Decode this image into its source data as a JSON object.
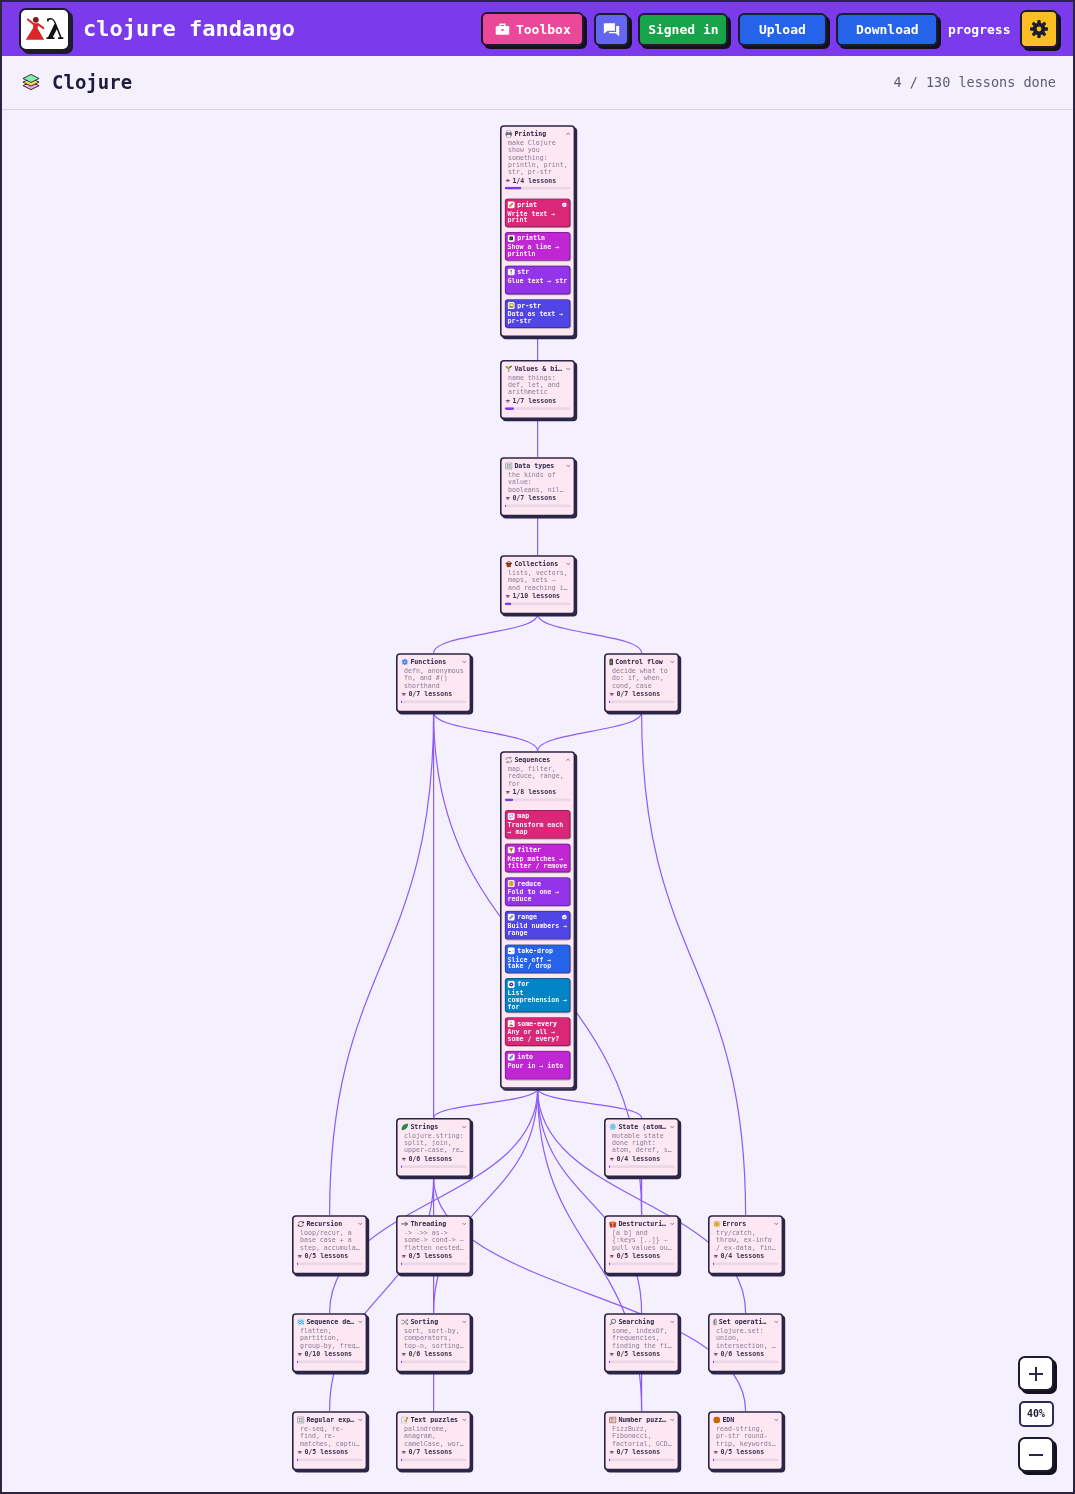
{
  "header": {
    "logo_glyph": "λ",
    "title": "clojure fandango",
    "actions": [
      {
        "kind": "toolbox",
        "label": "Toolbox"
      },
      {
        "kind": "chat"
      },
      {
        "kind": "account",
        "label": "Signed in"
      },
      {
        "kind": "upload",
        "label": "Upload"
      },
      {
        "kind": "download",
        "label": "Download"
      },
      {
        "kind": "link",
        "label": "progress"
      },
      {
        "kind": "settings"
      }
    ]
  },
  "course": {
    "title": "Clojure",
    "summary": "4 / 130 lessons done"
  },
  "nodes": [
    {
      "title": "Printing",
      "description": "make Clojure show you something: println, print, str, pr-str",
      "count": "1/4 lessons",
      "level": 0.25,
      "expanded": true,
      "lessons": [
        {
          "title": "print",
          "subtitle": "Write text → print",
          "done": true,
          "color": "#db2777"
        },
        {
          "title": "println",
          "subtitle": "Show a line → println",
          "done": false,
          "color": "#c026d3"
        },
        {
          "title": "str",
          "subtitle": "Glue text → str",
          "done": false,
          "color": "#9333ea"
        },
        {
          "title": "pr-str",
          "subtitle": "Data as text → pr-str",
          "done": false,
          "color": "#4f46e5"
        }
      ]
    },
    {
      "title": "Values & bi…",
      "description": "name things: def, let, and arithmetic",
      "count": "1/7 lessons",
      "level": 0.143,
      "expanded": false
    },
    {
      "title": "Data types",
      "description": "the kinds of value: booleans, nil…",
      "count": "0/7 lessons",
      "level": 0,
      "expanded": false
    },
    {
      "title": "Collections",
      "description": "lists, vectors, maps, sets — and reaching i…",
      "count": "1/10 lessons",
      "level": 0.1,
      "expanded": false
    },
    {
      "title": "Functions",
      "description": "defn, anonymous fn, and #() shorthand",
      "count": "0/7 lessons",
      "level": 0,
      "expanded": false
    },
    {
      "title": "Control flow",
      "description": "decide what to do: if, when, cond, case",
      "count": "0/7 lessons",
      "level": 0,
      "expanded": false
    },
    {
      "title": "Sequences",
      "description": "map, filter, reduce, range, for",
      "count": "1/8 lessons",
      "level": 0.125,
      "expanded": true,
      "lessons": [
        {
          "title": "map",
          "subtitle": "Transform each → map",
          "done": false,
          "color": "#db2777"
        },
        {
          "title": "filter",
          "subtitle": "Keep matches → filter / remove",
          "done": false,
          "color": "#c026d3"
        },
        {
          "title": "reduce",
          "subtitle": "Fold to one → reduce",
          "done": false,
          "color": "#9333ea"
        },
        {
          "title": "range",
          "subtitle": "Build numbers → range",
          "done": true,
          "color": "#4f46e5"
        },
        {
          "title": "take-drop",
          "subtitle": "Slice off → take / drop",
          "done": false,
          "color": "#2563eb"
        },
        {
          "title": "for",
          "subtitle": "List comprehension → for",
          "done": false,
          "color": "#0284c7"
        },
        {
          "title": "some-every",
          "subtitle": "Any or all → some / every?",
          "done": false,
          "color": "#db2777"
        },
        {
          "title": "into",
          "subtitle": "Pour in → into",
          "done": false,
          "color": "#c026d3"
        }
      ]
    },
    {
      "title": "Strings",
      "description": "clojure.string: split, join, upper-case, re…",
      "count": "0/6 lessons",
      "level": 0,
      "expanded": false
    },
    {
      "title": "State (atom…",
      "description": "mutable state done right: atom, deref, s…",
      "count": "0/4 lessons",
      "level": 0,
      "expanded": false
    },
    {
      "title": "Recursion",
      "description": "loop/recur, a base case + a step, accumula…",
      "count": "0/5 lessons",
      "level": 0,
      "expanded": false
    },
    {
      "title": "Threading",
      "description": "-> ->> as-> some-> cond-> — flatten nested…",
      "count": "0/5 lessons",
      "level": 0,
      "expanded": false
    },
    {
      "title": "Destructuri…",
      "description": "[a b] and {:keys [..]} — pull values ou…",
      "count": "0/5 lessons",
      "level": 0,
      "expanded": false
    },
    {
      "title": "Errors",
      "description": "try/catch, throw, ex-info / ex-data, fin…",
      "count": "0/4 lessons",
      "level": 0,
      "expanded": false
    },
    {
      "title": "Sequence de…",
      "description": "flatten, partition, group-by, freq…",
      "count": "0/10 lessons",
      "level": 0,
      "expanded": false
    },
    {
      "title": "Sorting",
      "description": "sort, sort-by, comparators, top-n, sorting…",
      "count": "0/6 lessons",
      "level": 0,
      "expanded": false
    },
    {
      "title": "Searching",
      "description": "some, indexOf, frequencies, finding the fi…",
      "count": "0/5 lessons",
      "level": 0,
      "expanded": false
    },
    {
      "title": "Set operati…",
      "description": "clojure.set: union, intersection, …",
      "count": "0/6 lessons",
      "level": 0,
      "expanded": false
    },
    {
      "title": "Regular exp…",
      "description": "re-seq, re-find, re-matches, captu…",
      "count": "0/5 lessons",
      "level": 0,
      "expanded": false
    },
    {
      "title": "Text puzzles",
      "description": "palindrome, anagram, camelCase, wor…",
      "count": "0/7 lessons",
      "level": 0,
      "expanded": false
    },
    {
      "title": "Number puzz…",
      "description": "FizzBuzz, Fibonacci, factorial, GCD…",
      "count": "0/7 lessons",
      "level": 0,
      "expanded": false
    },
    {
      "title": "EDN",
      "description": "read-string, pr-str round-trip, keywords…",
      "count": "0/5 lessons",
      "level": 0,
      "expanded": false
    }
  ],
  "zoom": {
    "label": "40%"
  }
}
